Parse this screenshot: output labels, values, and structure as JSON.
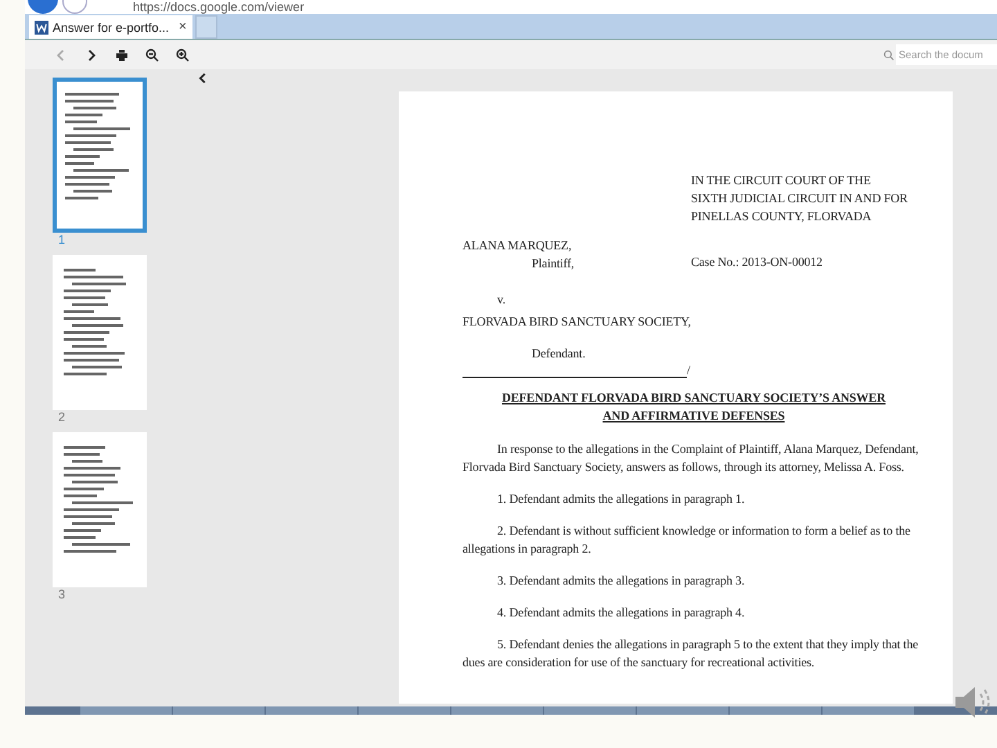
{
  "browser": {
    "address": "https://docs.google.com/viewer",
    "tab": {
      "title": "Answer for e-portfo...",
      "close": "×"
    }
  },
  "toolbar": {
    "back_disabled": true,
    "search_placeholder": "Search the docum"
  },
  "thumbnails": [
    {
      "number": "1",
      "selected": true
    },
    {
      "number": "2",
      "selected": false
    },
    {
      "number": "3",
      "selected": false
    }
  ],
  "document": {
    "court_lines": [
      "IN THE CIRCUIT COURT OF THE",
      "SIXTH JUDICIAL CIRCUIT IN AND FOR",
      "PINELLAS COUNTY, FLORVADA"
    ],
    "plaintiff_name": "ALANA MARQUEZ,",
    "case_no": "Case No.: 2013-ON-00012",
    "plaintiff_label": "Plaintiff,",
    "versus": "v.",
    "defendant_name": "FLORVADA BIRD SANCTUARY SOCIETY,",
    "defendant_label": "Defendant.",
    "slash": "/",
    "title_lines": [
      "DEFENDANT FLORVADA BIRD SANCTUARY SOCIETY’S ANSWER",
      "AND AFFIRMATIVE DEFENSES"
    ],
    "intro": "In response to the allegations in the Complaint of Plaintiff, Alana Marquez, Defendant, Florvada Bird Sanctuary Society, answers as follows, through its attorney, Melissa A. Foss.",
    "items": [
      "1.  Defendant admits the allegations in paragraph 1.",
      "2.  Defendant is without sufficient knowledge or information to form a belief as to the allegations in paragraph 2.",
      "3.  Defendant admits the allegations in paragraph 3.",
      "4.  Defendant admits the allegations in paragraph 4.",
      "5.  Defendant denies the allegations in paragraph 5 to the extent that they imply that the dues are consideration for use of the sanctuary for recreational activities."
    ]
  }
}
